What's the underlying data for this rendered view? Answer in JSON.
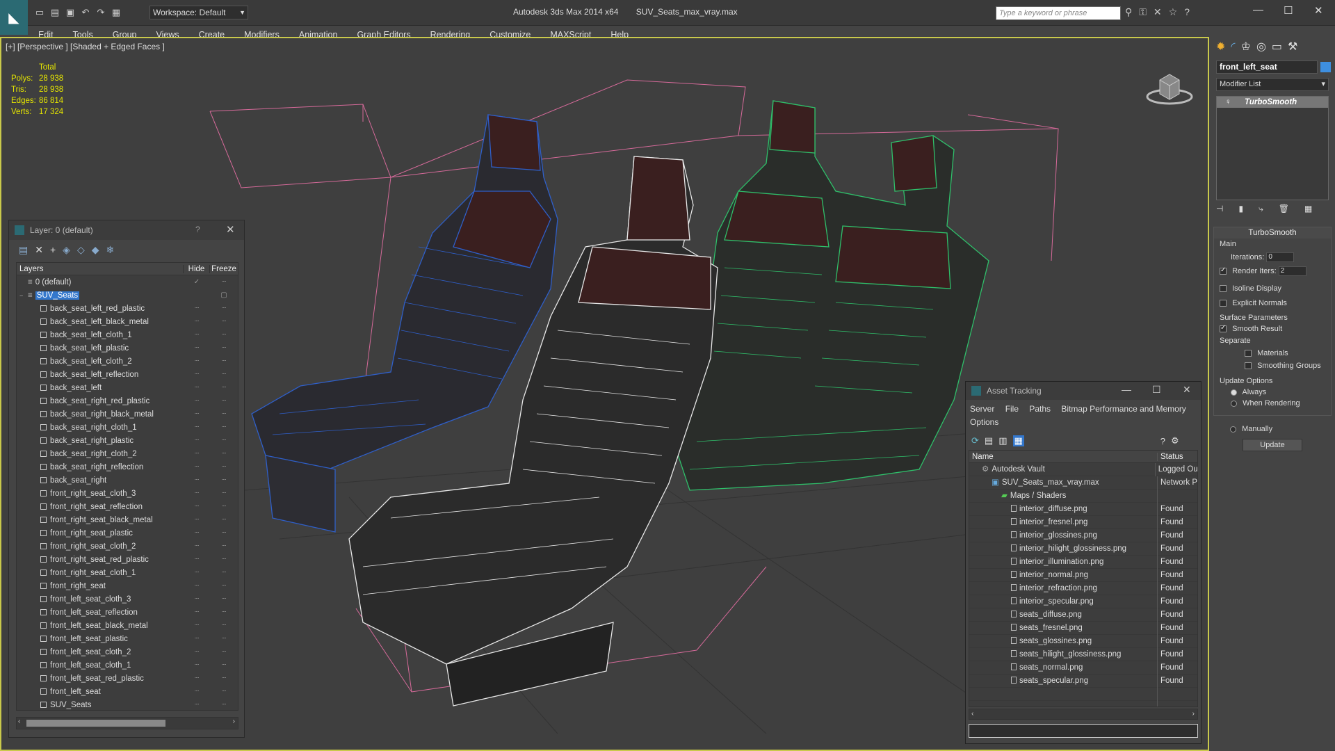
{
  "app": {
    "title": "Autodesk 3ds Max  2014 x64",
    "file": "SUV_Seats_max_vray.max",
    "workspace": "Workspace: Default",
    "search_placeholder": "Type a keyword or phrase"
  },
  "menu": [
    "Edit",
    "Tools",
    "Group",
    "Views",
    "Create",
    "Modifiers",
    "Animation",
    "Graph Editors",
    "Rendering",
    "Customize",
    "MAXScript",
    "Help"
  ],
  "viewport": {
    "label": "[+] [Perspective ] [Shaded + Edged Faces ]",
    "stats": {
      "header": "Total",
      "rows": [
        {
          "label": "Polys:",
          "value": "28 938"
        },
        {
          "label": "Tris:",
          "value": "28 938"
        },
        {
          "label": "Edges:",
          "value": "86 814"
        },
        {
          "label": "Verts:",
          "value": "17 324"
        }
      ]
    }
  },
  "layer_window": {
    "title": "Layer: 0 (default)",
    "columns": {
      "name": "Layers",
      "hide": "Hide",
      "freeze": "Freeze"
    },
    "layers": [
      {
        "name": "0 (default)",
        "level": 0
      },
      {
        "name": "SUV_Seats",
        "level": 0,
        "selected": true
      }
    ],
    "objects": [
      "back_seat_left_red_plastic",
      "back_seat_left_black_metal",
      "back_seat_left_cloth_1",
      "back_seat_left_plastic",
      "back_seat_left_cloth_2",
      "back_seat_left_reflection",
      "back_seat_left",
      "back_seat_right_red_plastic",
      "back_seat_right_black_metal",
      "back_seat_right_cloth_1",
      "back_seat_right_plastic",
      "back_seat_right_cloth_2",
      "back_seat_right_reflection",
      "back_seat_right",
      "front_right_seat_cloth_3",
      "front_right_seat_reflection",
      "front_right_seat_black_metal",
      "front_right_seat_plastic",
      "front_right_seat_cloth_2",
      "front_right_seat_red_plastic",
      "front_right_seat_cloth_1",
      "front_right_seat",
      "front_left_seat_cloth_3",
      "front_left_seat_reflection",
      "front_left_seat_black_metal",
      "front_left_seat_plastic",
      "front_left_seat_cloth_2",
      "front_left_seat_cloth_1",
      "front_left_seat_red_plastic",
      "front_left_seat",
      "SUV_Seats"
    ]
  },
  "command_panel": {
    "object_name": "front_left_seat",
    "object_color": "#3e8fe0",
    "modifier_list": "Modifier List",
    "modifier": "TurboSmooth",
    "turbosmooth": {
      "title": "TurboSmooth",
      "main": "Main",
      "iterations_label": "Iterations:",
      "iterations": "0",
      "render_iters_label": "Render Iters:",
      "render_iters": "2",
      "isoline": "Isoline Display",
      "explicit_normals": "Explicit Normals",
      "surface_params": "Surface Parameters",
      "smooth_result": "Smooth Result",
      "separate": "Separate",
      "materials": "Materials",
      "smoothing_groups": "Smoothing Groups",
      "update_options": "Update Options",
      "always": "Always",
      "when_rendering": "When Rendering",
      "manually": "Manually",
      "update": "Update"
    }
  },
  "asset_tracking": {
    "title": "Asset Tracking",
    "menu": [
      "Server",
      "File",
      "Paths",
      "Bitmap Performance and Memory",
      "Options"
    ],
    "columns": {
      "name": "Name",
      "status": "Status"
    },
    "rows": [
      {
        "name": "Autodesk Vault",
        "status": "Logged Ou",
        "indent": 1
      },
      {
        "name": "SUV_Seats_max_vray.max",
        "status": "Network P",
        "indent": 2
      },
      {
        "name": "Maps / Shaders",
        "status": "",
        "indent": 3
      },
      {
        "name": "interior_diffuse.png",
        "status": "Found",
        "indent": 4
      },
      {
        "name": "interior_fresnel.png",
        "status": "Found",
        "indent": 4
      },
      {
        "name": "interior_glossines.png",
        "status": "Found",
        "indent": 4
      },
      {
        "name": "interior_hilight_glossiness.png",
        "status": "Found",
        "indent": 4
      },
      {
        "name": "interior_illumination.png",
        "status": "Found",
        "indent": 4
      },
      {
        "name": "interior_normal.png",
        "status": "Found",
        "indent": 4
      },
      {
        "name": "interior_refraction.png",
        "status": "Found",
        "indent": 4
      },
      {
        "name": "interior_specular.png",
        "status": "Found",
        "indent": 4
      },
      {
        "name": "seats_diffuse.png",
        "status": "Found",
        "indent": 4
      },
      {
        "name": "seats_fresnel.png",
        "status": "Found",
        "indent": 4
      },
      {
        "name": "seats_glossines.png",
        "status": "Found",
        "indent": 4
      },
      {
        "name": "seats_hilight_glossiness.png",
        "status": "Found",
        "indent": 4
      },
      {
        "name": "seats_normal.png",
        "status": "Found",
        "indent": 4
      },
      {
        "name": "seats_specular.png",
        "status": "Found",
        "indent": 4
      }
    ]
  }
}
